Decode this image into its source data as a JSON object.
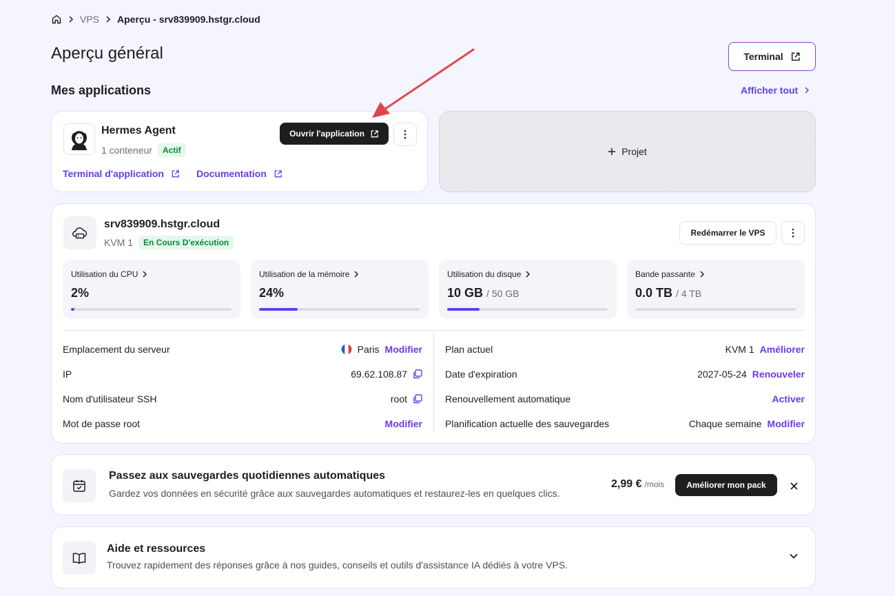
{
  "breadcrumb": {
    "home_icon": "home-icon",
    "level1": "VPS",
    "current": "Aperçu - srv839909.hstgr.cloud"
  },
  "page_title": "Aperçu général",
  "terminal_button": "Terminal",
  "apps": {
    "title": "Mes applications",
    "show_all": "Afficher tout",
    "app": {
      "name": "Hermes Agent",
      "containers": "1 conteneur",
      "status": "Actif",
      "open_button": "Ouvrir l'application",
      "terminal_link": "Terminal d'application",
      "docs_link": "Documentation"
    },
    "project_button": "Projet"
  },
  "server": {
    "hostname": "srv839909.hstgr.cloud",
    "plan": "KVM 1",
    "status": "En Cours D'exécution",
    "restart_button": "Redémarrer le VPS",
    "metrics": [
      {
        "label": "Utilisation du CPU",
        "value": "2%",
        "total": "",
        "percent": 2
      },
      {
        "label": "Utilisation de la mémoire",
        "value": "24%",
        "total": "",
        "percent": 24
      },
      {
        "label": "Utilisation du disque",
        "value": "10 GB",
        "total": "/ 50 GB",
        "percent": 20
      },
      {
        "label": "Bande passante",
        "value": "0.0 TB",
        "total": "/ 4 TB",
        "percent": 0
      }
    ],
    "left_rows": [
      {
        "label": "Emplacement du serveur",
        "value": "Paris",
        "action": "Modifier"
      },
      {
        "label": "IP",
        "value": "69.62.108.87"
      },
      {
        "label": "Nom d'utilisateur SSH",
        "value": "root"
      },
      {
        "label": "Mot de passe root",
        "value": "",
        "action": "Modifier"
      }
    ],
    "right_rows": [
      {
        "label": "Plan actuel",
        "value": "KVM 1",
        "action": "Améliorer"
      },
      {
        "label": "Date d'expiration",
        "value": "2027-05-24",
        "action": "Renouveler"
      },
      {
        "label": "Renouvellement automatique",
        "value": "",
        "action": "Activer"
      },
      {
        "label": "Planification actuelle des sauvegardes",
        "value": "Chaque semaine",
        "action": "Modifier"
      }
    ]
  },
  "upgrade": {
    "title": "Passez aux sauvegardes quotidiennes automatiques",
    "description": "Gardez vos données en sécurité grâce aux sauvegardes automatiques et restaurez-les en quelques clics.",
    "price": "2,99 €",
    "period": "/mois",
    "button": "Améliorer mon pack"
  },
  "help": {
    "title": "Aide et ressources",
    "description": "Trouvez rapidement des réponses grâce à nos guides, conseils et outils d'assistance IA dédiés à votre VPS."
  },
  "colors": {
    "accent": "#673de6",
    "success": "#008a3e",
    "annotation_arrow": "#e0474c"
  }
}
